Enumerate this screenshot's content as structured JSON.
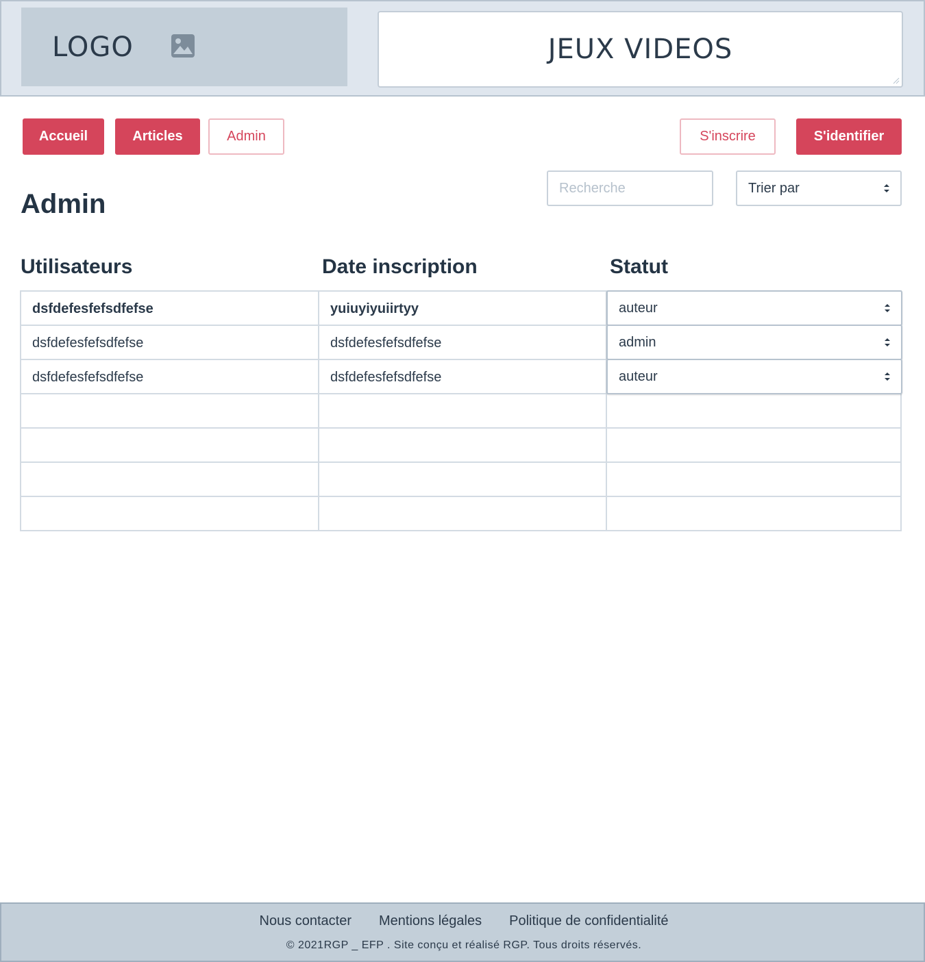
{
  "header": {
    "logo_text": "LOGO",
    "logo_icon": "image-icon",
    "site_title": "JEUX VIDEOS"
  },
  "nav": {
    "accueil": "Accueil",
    "articles": "Articles",
    "admin": "Admin",
    "sinscrire": "S'inscrire",
    "sidentifier": "S'identifier"
  },
  "page": {
    "title": "Admin"
  },
  "search": {
    "placeholder": "Recherche",
    "value": ""
  },
  "sort": {
    "selected": "Trier par"
  },
  "table": {
    "columns": [
      "Utilisateurs",
      "Date inscription",
      "Statut"
    ],
    "rows": [
      {
        "user": "dsfdefesfefsdfefse",
        "date": "yuiuyiyuiirtyy",
        "status": "auteur"
      },
      {
        "user": "dsfdefesfefsdfefse",
        "date": "dsfdefesfefsdfefse",
        "status": "admin"
      },
      {
        "user": "dsfdefesfefsdfefse",
        "date": "dsfdefesfefsdfefse",
        "status": "auteur"
      }
    ]
  },
  "footer": {
    "links": [
      "Nous contacter",
      "Mentions légales",
      "Politique de confidentialité"
    ],
    "copyright": "© 2021RGP _ EFP . Site conçu et réalisé  RGP. Tous droits réservés."
  },
  "colors": {
    "accent": "#d5455b",
    "header_bg": "#dfe6ee",
    "logo_bg": "#c3cfd9",
    "text": "#2b3a4a"
  }
}
